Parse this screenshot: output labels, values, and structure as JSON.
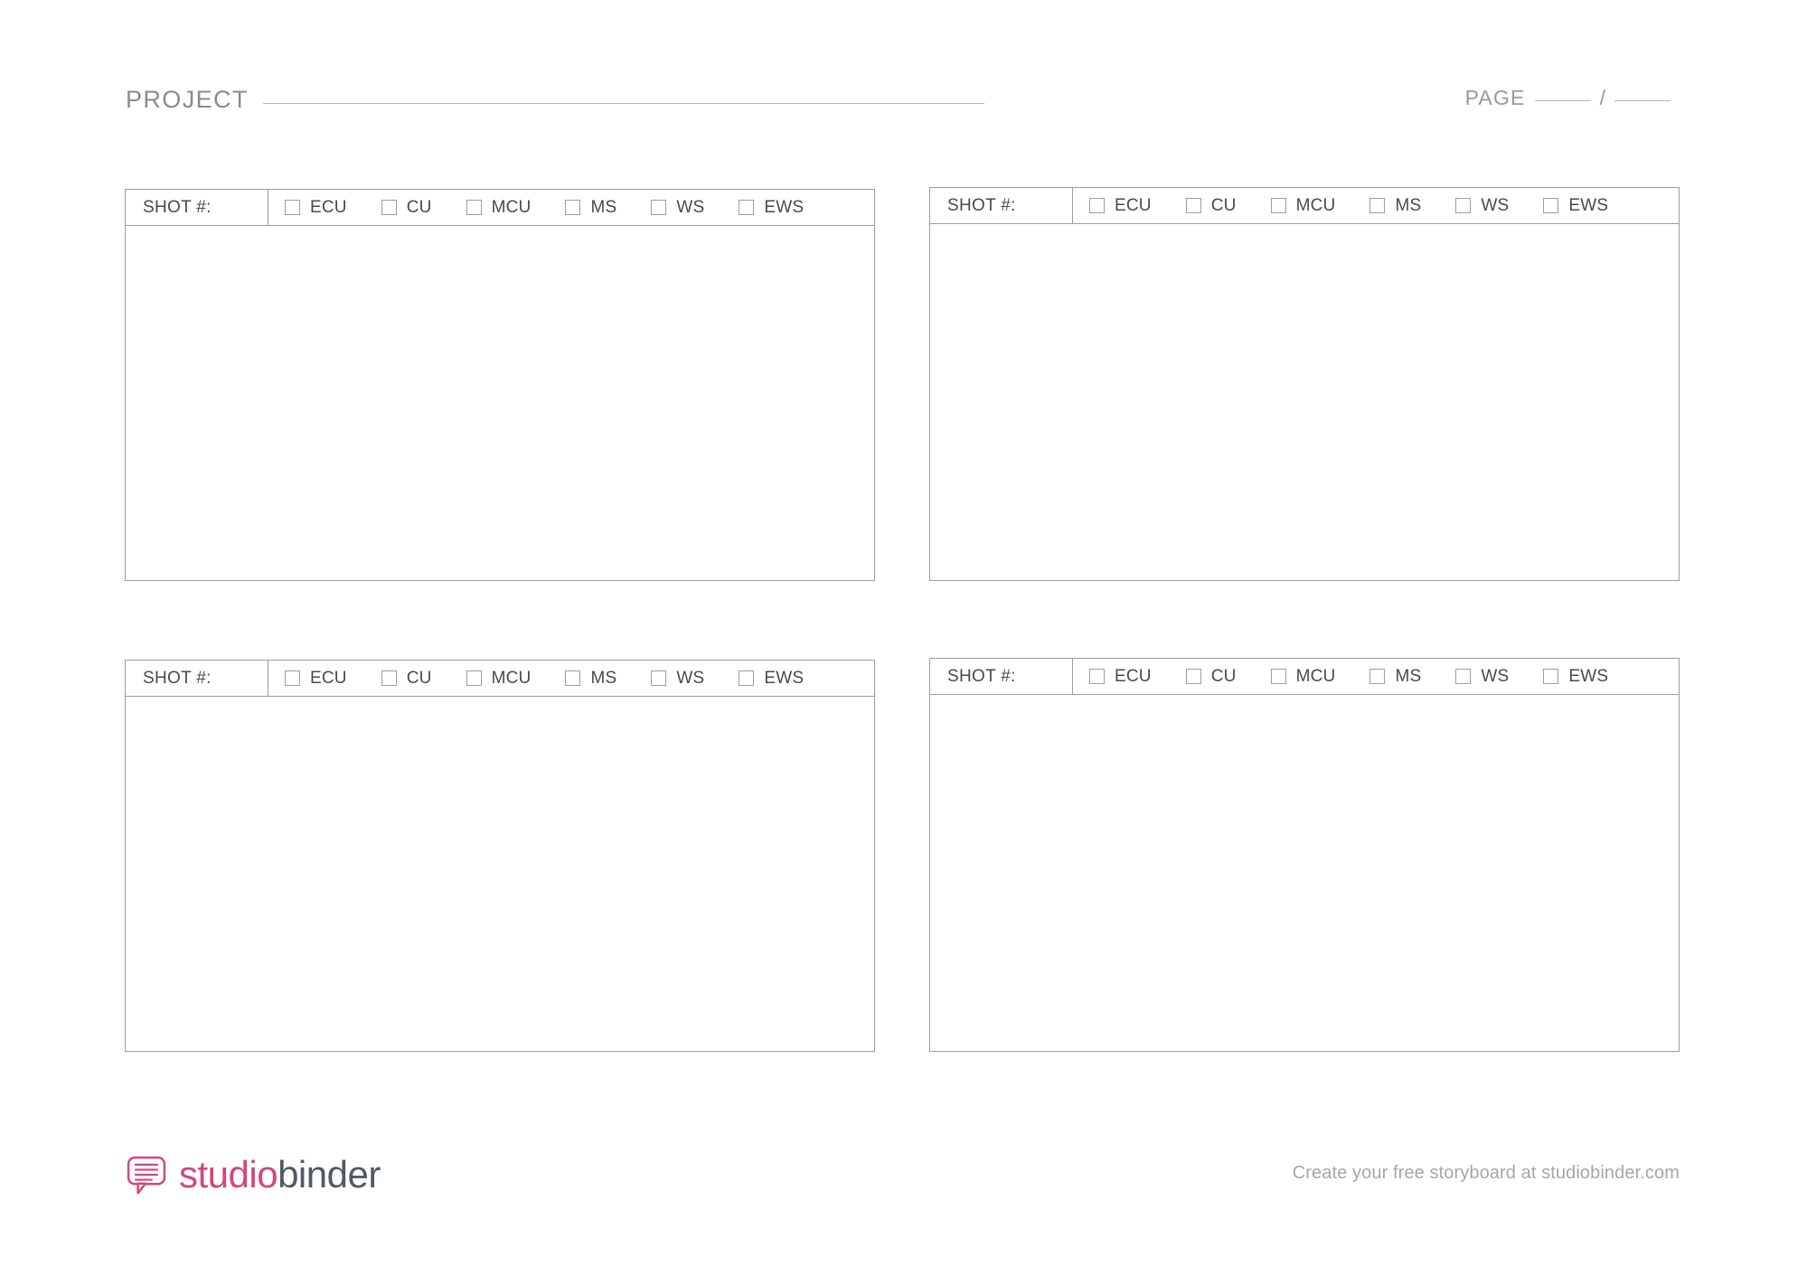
{
  "document": {
    "type": "storyboard-template",
    "orientation": "landscape"
  },
  "header": {
    "project_label": "PROJECT",
    "project_value": "",
    "page_label": "PAGE",
    "page_current": "",
    "page_separator": "/",
    "page_total": ""
  },
  "shot_types": [
    "ECU",
    "CU",
    "MCU",
    "MS",
    "WS",
    "EWS"
  ],
  "panels": [
    {
      "id": "panel-1",
      "shot_label": "SHOT #:",
      "shot_value": "",
      "checked": [],
      "image_caption": ""
    },
    {
      "id": "panel-2",
      "shot_label": "SHOT #:",
      "shot_value": "",
      "checked": [],
      "image_caption": ""
    },
    {
      "id": "panel-3",
      "shot_label": "SHOT #:",
      "shot_value": "",
      "checked": [],
      "image_caption": ""
    },
    {
      "id": "panel-4",
      "shot_label": "SHOT #:",
      "shot_value": "",
      "checked": [],
      "image_caption": ""
    }
  ],
  "footer": {
    "brand_first": "studio",
    "brand_second": "binder",
    "note": "Create your free storyboard at studiobinder.com",
    "logo_icon": "speech-bubble-icon"
  },
  "colors": {
    "brand_pink": "#d1487a",
    "brand_dark": "#4f5a63",
    "rule_gray": "#b4b4b4",
    "border_gray": "#9d9d9d",
    "label_gray": "#8b8b8b",
    "text_gray": "#4a4a4a",
    "muted_gray": "#a6a6a6",
    "page_bg": "#ffffff"
  }
}
